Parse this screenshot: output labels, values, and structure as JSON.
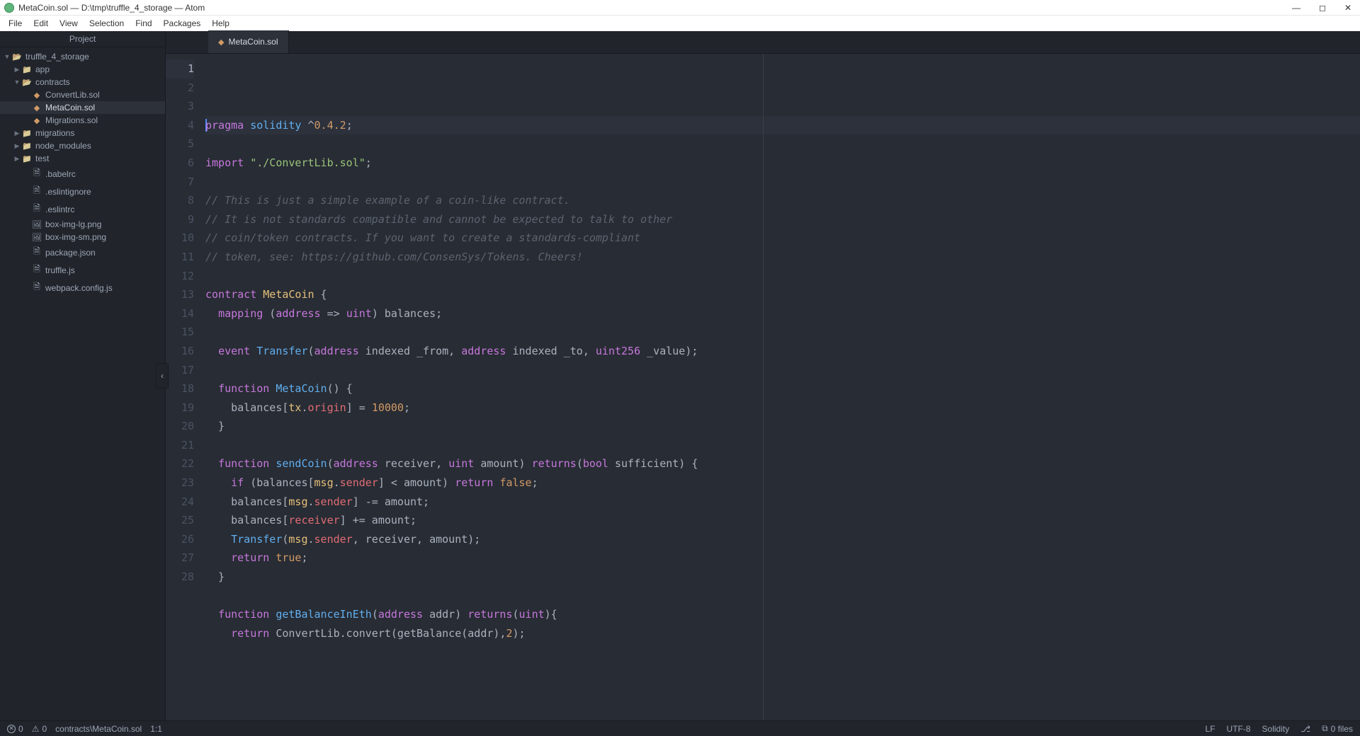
{
  "titlebar": {
    "title": "MetaCoin.sol — D:\\tmp\\truffle_4_storage — Atom"
  },
  "menubar": [
    "File",
    "Edit",
    "View",
    "Selection",
    "Find",
    "Packages",
    "Help"
  ],
  "sidebar": {
    "header": "Project",
    "tree": [
      {
        "depth": 0,
        "icon": "folder-open",
        "arrow": "▼",
        "label": "truffle_4_storage"
      },
      {
        "depth": 1,
        "icon": "folder",
        "arrow": "▶",
        "label": "app"
      },
      {
        "depth": 1,
        "icon": "folder-open",
        "arrow": "▼",
        "label": "contracts"
      },
      {
        "depth": 2,
        "icon": "sol",
        "arrow": "",
        "label": "ConvertLib.sol"
      },
      {
        "depth": 2,
        "icon": "sol",
        "arrow": "",
        "label": "MetaCoin.sol",
        "selected": true
      },
      {
        "depth": 2,
        "icon": "sol",
        "arrow": "",
        "label": "Migrations.sol"
      },
      {
        "depth": 1,
        "icon": "folder",
        "arrow": "▶",
        "label": "migrations"
      },
      {
        "depth": 1,
        "icon": "folder",
        "arrow": "▶",
        "label": "node_modules"
      },
      {
        "depth": 1,
        "icon": "folder",
        "arrow": "▶",
        "label": "test"
      },
      {
        "depth": 2,
        "icon": "file",
        "arrow": "",
        "label": ".babelrc"
      },
      {
        "depth": 2,
        "icon": "file",
        "arrow": "",
        "label": ".eslintignore"
      },
      {
        "depth": 2,
        "icon": "file",
        "arrow": "",
        "label": ".eslintrc"
      },
      {
        "depth": 2,
        "icon": "img",
        "arrow": "",
        "label": "box-img-lg.png"
      },
      {
        "depth": 2,
        "icon": "img",
        "arrow": "",
        "label": "box-img-sm.png"
      },
      {
        "depth": 2,
        "icon": "file",
        "arrow": "",
        "label": "package.json"
      },
      {
        "depth": 2,
        "icon": "file",
        "arrow": "",
        "label": "truffle.js"
      },
      {
        "depth": 2,
        "icon": "file",
        "arrow": "",
        "label": "webpack.config.js"
      }
    ]
  },
  "tab": {
    "label": "MetaCoin.sol"
  },
  "editor": {
    "lines": [
      [
        {
          "t": "pragma",
          "c": "kw"
        },
        {
          "t": " "
        },
        {
          "t": "solidity",
          "c": "fn"
        },
        {
          "t": " ^"
        },
        {
          "t": "0.4.2",
          "c": "num"
        },
        {
          "t": ";"
        }
      ],
      [],
      [
        {
          "t": "import",
          "c": "kw"
        },
        {
          "t": " "
        },
        {
          "t": "\"./ConvertLib.sol\"",
          "c": "str"
        },
        {
          "t": ";"
        }
      ],
      [],
      [
        {
          "t": "// This is just a simple example of a coin-like contract.",
          "c": "cm"
        }
      ],
      [
        {
          "t": "// It is not standards compatible and cannot be expected to talk to other",
          "c": "cm"
        }
      ],
      [
        {
          "t": "// coin/token contracts. If you want to create a standards-compliant",
          "c": "cm"
        }
      ],
      [
        {
          "t": "// token, see: https://github.com/ConsenSys/Tokens. Cheers!",
          "c": "cm"
        }
      ],
      [],
      [
        {
          "t": "contract",
          "c": "kw"
        },
        {
          "t": " "
        },
        {
          "t": "MetaCoin",
          "c": "cls"
        },
        {
          "t": " {"
        }
      ],
      [
        {
          "t": "  "
        },
        {
          "t": "mapping",
          "c": "kw"
        },
        {
          "t": " ("
        },
        {
          "t": "address",
          "c": "type"
        },
        {
          "t": " => "
        },
        {
          "t": "uint",
          "c": "type"
        },
        {
          "t": ") balances;"
        }
      ],
      [],
      [
        {
          "t": "  "
        },
        {
          "t": "event",
          "c": "kw"
        },
        {
          "t": " "
        },
        {
          "t": "Transfer",
          "c": "fn"
        },
        {
          "t": "("
        },
        {
          "t": "address",
          "c": "type"
        },
        {
          "t": " indexed _from, "
        },
        {
          "t": "address",
          "c": "type"
        },
        {
          "t": " indexed _to, "
        },
        {
          "t": "uint256",
          "c": "type"
        },
        {
          "t": " _value);"
        }
      ],
      [],
      [
        {
          "t": "  "
        },
        {
          "t": "function",
          "c": "kw"
        },
        {
          "t": " "
        },
        {
          "t": "MetaCoin",
          "c": "fn"
        },
        {
          "t": "() {"
        }
      ],
      [
        {
          "t": "    balances["
        },
        {
          "t": "tx",
          "c": "builtin"
        },
        {
          "t": "."
        },
        {
          "t": "origin",
          "c": "var"
        },
        {
          "t": "] = "
        },
        {
          "t": "10000",
          "c": "num"
        },
        {
          "t": ";"
        }
      ],
      [
        {
          "t": "  }"
        }
      ],
      [],
      [
        {
          "t": "  "
        },
        {
          "t": "function",
          "c": "kw"
        },
        {
          "t": " "
        },
        {
          "t": "sendCoin",
          "c": "fn"
        },
        {
          "t": "("
        },
        {
          "t": "address",
          "c": "type"
        },
        {
          "t": " receiver, "
        },
        {
          "t": "uint",
          "c": "type"
        },
        {
          "t": " amount) "
        },
        {
          "t": "returns",
          "c": "kw"
        },
        {
          "t": "("
        },
        {
          "t": "bool",
          "c": "type"
        },
        {
          "t": " sufficient) {"
        }
      ],
      [
        {
          "t": "    "
        },
        {
          "t": "if",
          "c": "kw"
        },
        {
          "t": " (balances["
        },
        {
          "t": "msg",
          "c": "builtin"
        },
        {
          "t": "."
        },
        {
          "t": "sender",
          "c": "var"
        },
        {
          "t": "] < amount) "
        },
        {
          "t": "return",
          "c": "kw"
        },
        {
          "t": " "
        },
        {
          "t": "false",
          "c": "bool"
        },
        {
          "t": ";"
        }
      ],
      [
        {
          "t": "    balances["
        },
        {
          "t": "msg",
          "c": "builtin"
        },
        {
          "t": "."
        },
        {
          "t": "sender",
          "c": "var"
        },
        {
          "t": "] -= amount;"
        }
      ],
      [
        {
          "t": "    balances["
        },
        {
          "t": "receiver",
          "c": "var"
        },
        {
          "t": "] += amount;"
        }
      ],
      [
        {
          "t": "    "
        },
        {
          "t": "Transfer",
          "c": "fn"
        },
        {
          "t": "("
        },
        {
          "t": "msg",
          "c": "builtin"
        },
        {
          "t": "."
        },
        {
          "t": "sender",
          "c": "var"
        },
        {
          "t": ", receiver, amount);"
        }
      ],
      [
        {
          "t": "    "
        },
        {
          "t": "return",
          "c": "kw"
        },
        {
          "t": " "
        },
        {
          "t": "true",
          "c": "bool"
        },
        {
          "t": ";"
        }
      ],
      [
        {
          "t": "  }"
        }
      ],
      [],
      [
        {
          "t": "  "
        },
        {
          "t": "function",
          "c": "kw"
        },
        {
          "t": " "
        },
        {
          "t": "getBalanceInEth",
          "c": "fn"
        },
        {
          "t": "("
        },
        {
          "t": "address",
          "c": "type"
        },
        {
          "t": " addr) "
        },
        {
          "t": "returns",
          "c": "kw"
        },
        {
          "t": "("
        },
        {
          "t": "uint",
          "c": "type"
        },
        {
          "t": "){"
        }
      ],
      [
        {
          "t": "    "
        },
        {
          "t": "return",
          "c": "kw"
        },
        {
          "t": " ConvertLib.convert(getBalance(addr),"
        },
        {
          "t": "2",
          "c": "num"
        },
        {
          "t": ");"
        }
      ]
    ],
    "active_line": 1
  },
  "statusbar": {
    "err_icon": "✕",
    "err_count": "0",
    "warn_icon": "⚠",
    "warn_count": "0",
    "path": "contracts\\MetaCoin.sol",
    "cursor": "1:1",
    "line_ending": "LF",
    "encoding": "UTF-8",
    "grammar": "Solidity",
    "branch_icon": "⎇",
    "files_icon": "⧉",
    "files": "0 files"
  }
}
